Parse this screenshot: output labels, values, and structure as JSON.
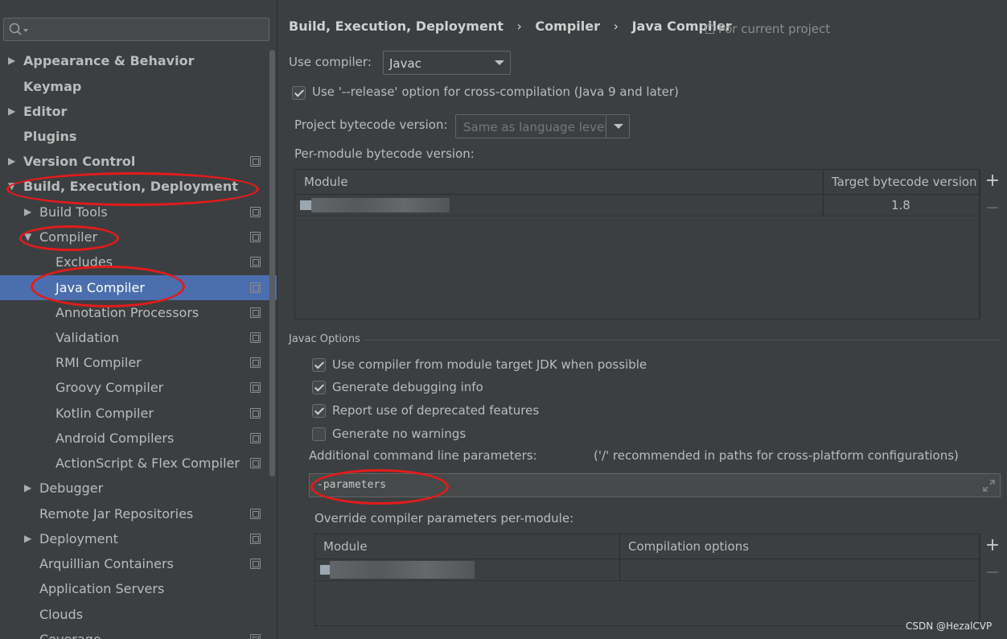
{
  "sidebar": {
    "search_placeholder": "",
    "items": [
      {
        "label": "Appearance & Behavior"
      },
      {
        "label": "Keymap"
      },
      {
        "label": "Editor"
      },
      {
        "label": "Plugins"
      },
      {
        "label": "Version Control"
      },
      {
        "label": "Build, Execution, Deployment"
      },
      {
        "label": "Build Tools"
      },
      {
        "label": "Compiler"
      },
      {
        "label": "Excludes"
      },
      {
        "label": "Java Compiler"
      },
      {
        "label": "Annotation Processors"
      },
      {
        "label": "Validation"
      },
      {
        "label": "RMI Compiler"
      },
      {
        "label": "Groovy Compiler"
      },
      {
        "label": "Kotlin Compiler"
      },
      {
        "label": "Android Compilers"
      },
      {
        "label": "ActionScript & Flex Compiler"
      },
      {
        "label": "Debugger"
      },
      {
        "label": "Remote Jar Repositories"
      },
      {
        "label": "Deployment"
      },
      {
        "label": "Arquillian Containers"
      },
      {
        "label": "Application Servers"
      },
      {
        "label": "Clouds"
      },
      {
        "label": "Coverage"
      }
    ]
  },
  "header": {
    "crumbs": [
      "Build, Execution, Deployment",
      "Compiler",
      "Java Compiler"
    ],
    "separator": "›",
    "scope": "For current project"
  },
  "main": {
    "use_compiler_label": "Use compiler:",
    "use_compiler_value": "Javac",
    "release_option_label": "Use '--release' option for cross-compilation (Java 9 and later)",
    "project_bytecode_label": "Project bytecode version:",
    "project_bytecode_value": "Same as language level",
    "per_module_label": "Per-module bytecode version:",
    "bytecode_table": {
      "columns": [
        "Module",
        "Target bytecode version"
      ],
      "rows": [
        {
          "module": "",
          "version": "1.8"
        }
      ]
    },
    "javac_options_title": "Javac Options",
    "options": [
      {
        "label": "Use compiler from module target JDK when possible",
        "checked": true
      },
      {
        "label": "Generate debugging info",
        "checked": true
      },
      {
        "label": "Report use of deprecated features",
        "checked": true
      },
      {
        "label": "Generate no warnings",
        "checked": false
      }
    ],
    "additional_params_label": "Additional command line parameters:",
    "additional_params_hint": "('/' recommended in paths for cross-platform configurations)",
    "additional_params_value": "-parameters",
    "override_label": "Override compiler parameters per-module:",
    "override_table": {
      "columns": [
        "Module",
        "Compilation options"
      ]
    },
    "plus": "+",
    "minus": "−"
  },
  "watermark": "CSDN @HezalCVP",
  "colors": {
    "background": "#3c3f41",
    "selection": "#4b6eaf",
    "annotation": "#e31b1b"
  }
}
